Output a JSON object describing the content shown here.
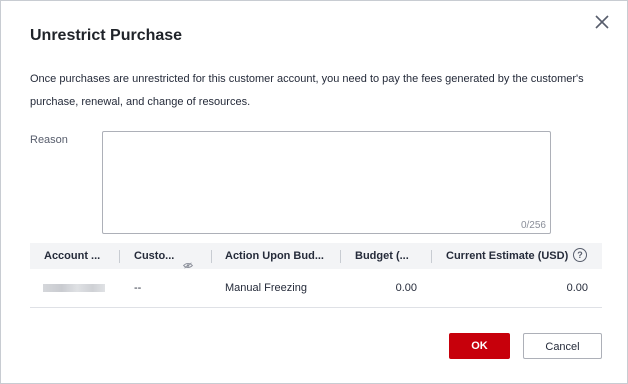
{
  "dialog": {
    "title": "Unrestrict Purchase",
    "description": "Once purchases are unrestricted for this customer account, you need to pay the fees generated by the customer's purchase, renewal, and change of resources."
  },
  "reason": {
    "label": "Reason",
    "value": "",
    "counter": "0/256"
  },
  "table": {
    "headers": {
      "account": "Account ...",
      "customer": "Custo...",
      "action": "Action Upon Bud...",
      "budget": "Budget (...",
      "estimate": "Current Estimate (USD)"
    },
    "rows": [
      {
        "account": "",
        "customer": "--",
        "action": "Manual Freezing",
        "budget": "0.00",
        "estimate": "0.00"
      }
    ]
  },
  "buttons": {
    "ok": "OK",
    "cancel": "Cancel"
  },
  "icons": {
    "close": "close-icon",
    "eye": "eye-icon",
    "help": "help-icon"
  },
  "colors": {
    "primary": "#c7000b",
    "header_bg": "#f3f4f6",
    "border": "#adb0b8"
  }
}
